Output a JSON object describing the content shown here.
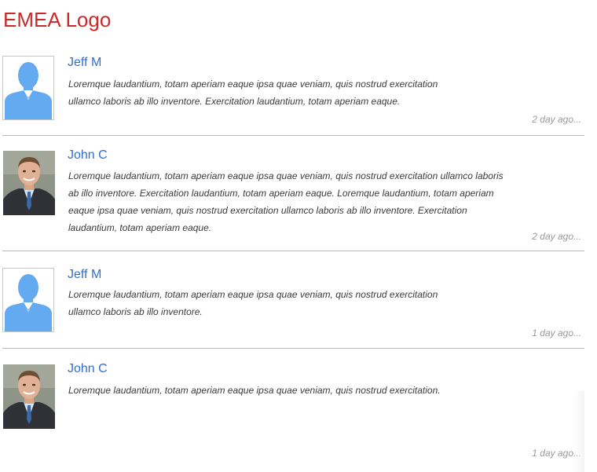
{
  "header": {
    "logo_text": "EMEA Logo"
  },
  "colors": {
    "logo": "#cc2a2a",
    "author_name": "#2d6fd0",
    "placeholder_avatar": "#64aaf0",
    "divider": "#b8b8b8"
  },
  "posts": [
    {
      "author": "Jeff M",
      "avatar": "placeholder-silhouette-icon",
      "text": "Loremque laudantium, totam aperiam eaque ipsa quae veniam, quis nostrud exercitation ullamco laboris ab illo inventore. Exercitation laudantium, totam aperiam eaque.",
      "time": "2 day ago..."
    },
    {
      "author": "John C",
      "avatar": "user-photo",
      "text": "Loremque laudantium, totam aperiam eaque ipsa quae veniam, quis nostrud exercitation ullamco laboris ab illo inventore. Exercitation laudantium, totam aperiam eaque. Loremque laudantium, totam aperiam eaque ipsa quae veniam, quis nostrud exercitation ullamco laboris ab illo inventore. Exercitation laudantium, totam aperiam eaque.",
      "time": "2 day ago..."
    },
    {
      "author": "Jeff M",
      "avatar": "placeholder-silhouette-icon",
      "text": "Loremque laudantium, totam aperiam eaque ipsa quae veniam, quis nostrud exercitation ullamco laboris ab illo inventore.",
      "time": "1 day ago..."
    },
    {
      "author": "John C",
      "avatar": "user-photo",
      "text": "Loremque laudantium, totam aperiam eaque ipsa quae veniam, quis nostrud exercitation.",
      "time": "1 day ago..."
    }
  ]
}
